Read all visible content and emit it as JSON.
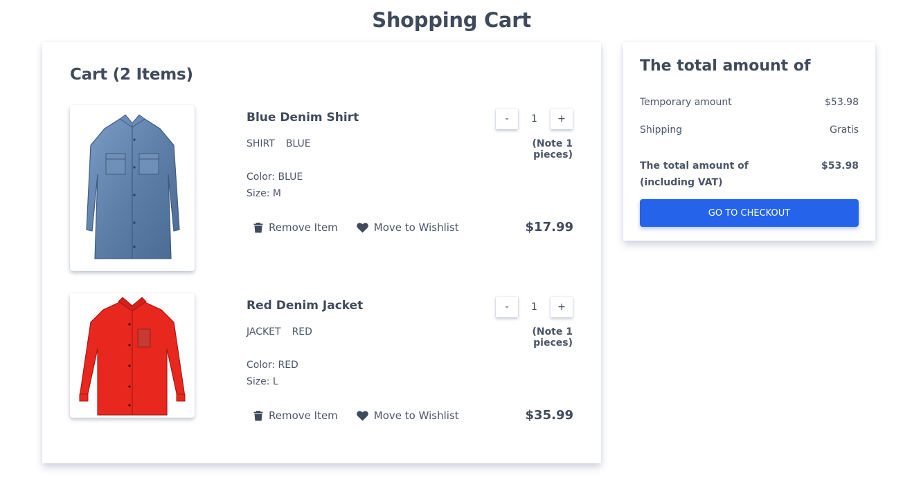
{
  "page": {
    "title": "Shopping Cart"
  },
  "cart": {
    "heading": "Cart (2 Items)",
    "items": [
      {
        "name": "Blue Denim Shirt",
        "tags": [
          "SHIRT",
          "BLUE"
        ],
        "color": "Color: BLUE",
        "size": "Size: M",
        "quantity": "1",
        "decrement": "-",
        "increment": "+",
        "note": "(Note 1 pieces)",
        "remove_label": "Remove Item",
        "wishlist_label": "Move to Wishlist",
        "price": "$17.99",
        "image_icon": "denim-shirt-image",
        "image_color": "#5d7fa8"
      },
      {
        "name": "Red Denim Jacket",
        "tags": [
          "JACKET",
          "RED"
        ],
        "color": "Color: RED",
        "size": "Size: L",
        "quantity": "1",
        "decrement": "-",
        "increment": "+",
        "note": "(Note 1 pieces)",
        "remove_label": "Remove Item",
        "wishlist_label": "Move to Wishlist",
        "price": "$35.99",
        "image_icon": "red-jacket-image",
        "image_color": "#e8281f"
      }
    ]
  },
  "summary": {
    "title": "The total amount of",
    "temporary_label": "Temporary amount",
    "temporary_value": "$53.98",
    "shipping_label": "Shipping",
    "shipping_value": "Gratis",
    "total_label": "The total amount of (including VAT)",
    "total_value": "$53.98",
    "checkout_label": "GO TO CHECKOUT"
  },
  "colors": {
    "accent": "#2563eb",
    "text": "#3f4a5c"
  }
}
